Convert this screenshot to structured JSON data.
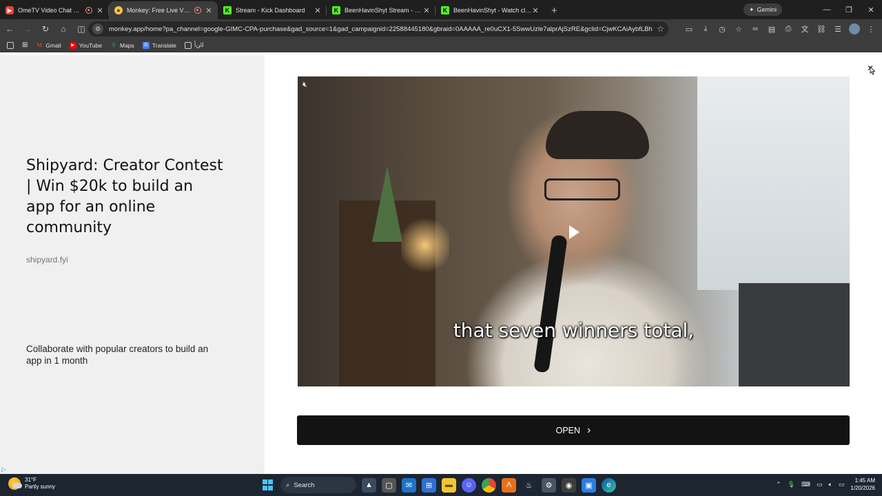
{
  "browser": {
    "tabs": [
      {
        "title": "OmeTV Video Chat — Ome",
        "favicon": "ometv-icon",
        "recording": true,
        "active": false
      },
      {
        "title": "Monkey: Free Live Video Ch",
        "favicon": "monkey-icon",
        "recording": true,
        "active": true
      },
      {
        "title": "Stream - Kick Dashboard",
        "favicon": "kick-icon",
        "recording": false,
        "active": false
      },
      {
        "title": "BeenHavinShyt Stream - Watch",
        "favicon": "kick-icon",
        "recording": false,
        "active": false
      },
      {
        "title": "BeenHavinShyt - Watch clips o",
        "favicon": "kick-icon",
        "recording": false,
        "active": false
      }
    ],
    "gemini_label": "Gemini",
    "url": "monkey.app/home?pa_channel=google-GIMC-CPA-purchase&gad_source=1&gad_campaignid=22588445180&gbraid=0AAAAA_re0uCX1-5SwwUzle7alprAjSzRE&gclid=CjwKCAiAybfLBhAjEi...",
    "bookmarks": [
      {
        "label": "Gmail",
        "icon": "gmail-icon"
      },
      {
        "label": "YouTube",
        "icon": "youtube-icon"
      },
      {
        "label": "Maps",
        "icon": "maps-icon"
      },
      {
        "label": "Translate",
        "icon": "translate-icon"
      },
      {
        "label": "ﻟﺍﻦﺃ",
        "icon": "folder-icon"
      }
    ]
  },
  "ad": {
    "title": "Shipyard: Creator Contest | Win $20k to build an app for an online community",
    "domain": "shipyard.fyi",
    "description": "Collaborate with popular creators to build an app in 1 month",
    "video_caption": "that seven winners total,",
    "open_label": "OPEN",
    "close_glyph": "✕"
  },
  "taskbar": {
    "weather_temp": "31°F",
    "weather_desc": "Partly sunny",
    "search_label": "Search",
    "time": "1:45 AM",
    "date": "1/20/2026"
  }
}
